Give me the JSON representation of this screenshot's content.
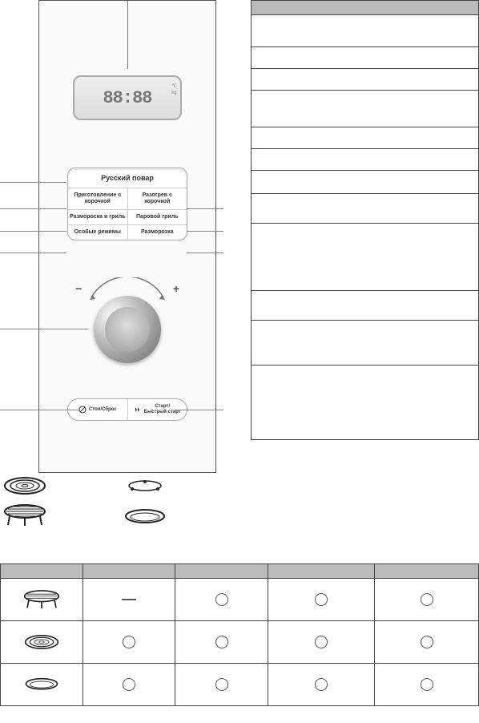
{
  "display": {
    "digits": "88:88",
    "unit_c": "℃",
    "unit_kg": "kg"
  },
  "buttons": {
    "big": "Русский повар",
    "row1": {
      "left": "Приготовление\nс корочкой",
      "right": "Разогрев с\nкорочкой"
    },
    "row2": {
      "left": "Размороска\nи гриль",
      "right": "Паровой\nгриль"
    },
    "row3": {
      "left": "Особые режимы",
      "right": "Разморозка"
    }
  },
  "dial": {
    "minus": "−",
    "plus": "+"
  },
  "bottom_bar": {
    "left": "Стоп/Сброс",
    "right": "Старт/\nБыстрый старт"
  },
  "right_table": {
    "rows": [
      {
        "h": 19
      },
      {
        "h": 40
      },
      {
        "h": 27
      },
      {
        "h": 27
      },
      {
        "h": 46
      },
      {
        "h": 27
      },
      {
        "h": 27
      },
      {
        "h": 29
      },
      {
        "h": 37
      },
      {
        "h": 84
      },
      {
        "h": 37
      },
      {
        "h": 56
      },
      {
        "h": 92
      }
    ]
  },
  "usage_table": {
    "rows": [
      {
        "cells": [
          "",
          "",
          "",
          "",
          ""
        ]
      },
      {
        "icon": "grill-rack",
        "cells": [
          "dash",
          "circle",
          "circle",
          "circle"
        ]
      },
      {
        "icon": "crisp-plate",
        "cells": [
          "circle",
          "circle",
          "circle",
          "circle"
        ]
      },
      {
        "icon": "tray",
        "cells": [
          "circle",
          "circle",
          "circle",
          "circle"
        ]
      }
    ]
  },
  "icons": {
    "crisp_plate": "crisp-plate-icon",
    "grill_rack": "grill-rack-icon",
    "ring": "ring-icon",
    "tray": "tray-icon"
  }
}
